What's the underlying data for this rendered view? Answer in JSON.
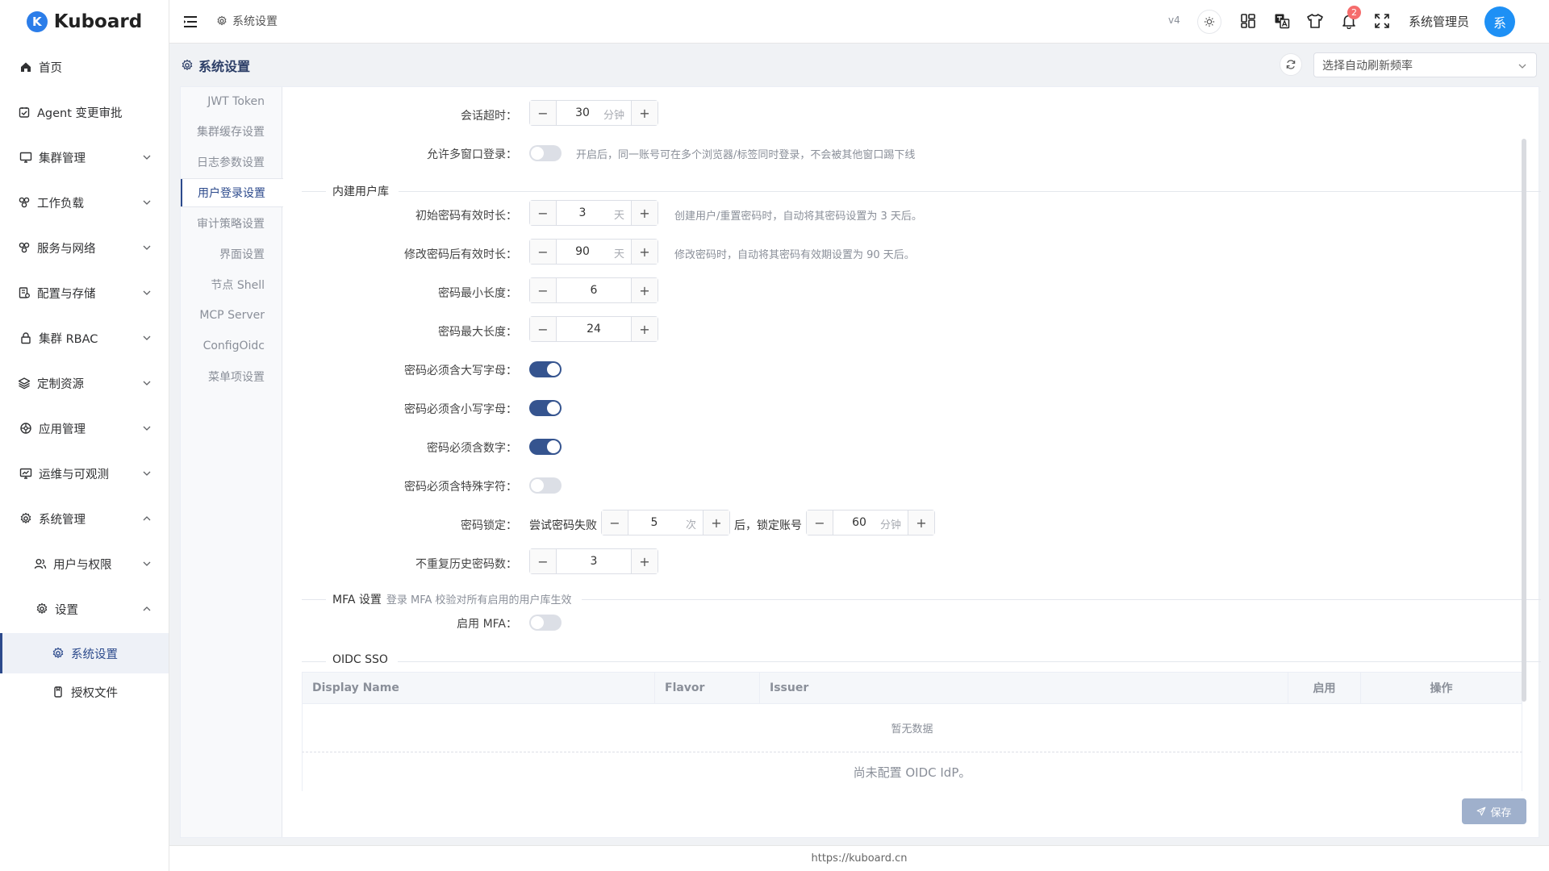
{
  "app": {
    "logo_letter": "K",
    "logo_name": "Kuboard"
  },
  "sidebar": {
    "items": [
      {
        "label": "首页"
      },
      {
        "label": "Agent 变更审批"
      },
      {
        "label": "集群管理"
      },
      {
        "label": "工作负载"
      },
      {
        "label": "服务与网络"
      },
      {
        "label": "配置与存储"
      },
      {
        "label": "集群 RBAC"
      },
      {
        "label": "定制资源"
      },
      {
        "label": "应用管理"
      },
      {
        "label": "运维与可观测"
      },
      {
        "label": "系统管理"
      },
      {
        "label": "用户与权限"
      },
      {
        "label": "设置"
      },
      {
        "label": "系统设置"
      },
      {
        "label": "授权文件"
      }
    ]
  },
  "header": {
    "breadcrumb": "系统设置",
    "version": "v4",
    "notification_count": "2",
    "user_name": "系统管理员",
    "avatar_text": "系"
  },
  "page": {
    "title": "系统设置",
    "refresh_placeholder": "选择自动刷新频率"
  },
  "tabs": [
    {
      "label": "JWT Token"
    },
    {
      "label": "集群缓存设置"
    },
    {
      "label": "日志参数设置"
    },
    {
      "label": "用户登录设置"
    },
    {
      "label": "审计策略设置"
    },
    {
      "label": "界面设置"
    },
    {
      "label": "节点 Shell"
    },
    {
      "label": "MCP Server"
    },
    {
      "label": "ConfigOidc"
    },
    {
      "label": "菜单项设置"
    }
  ],
  "form": {
    "session_timeout": {
      "label": "会话超时：",
      "value": "30",
      "unit": "分钟"
    },
    "multi_window": {
      "label": "允许多窗口登录：",
      "enabled": false,
      "hint": "开启后，同一账号可在多个浏览器/标签同时登录，不会被其他窗口踢下线"
    },
    "builtin_section": "内建用户库",
    "init_pwd_valid": {
      "label": "初始密码有效时长：",
      "value": "3",
      "unit": "天",
      "hint": "创建用户/重置密码时，自动将其密码设置为 3 天后。"
    },
    "changed_pwd_valid": {
      "label": "修改密码后有效时长：",
      "value": "90",
      "unit": "天",
      "hint": "修改密码时，自动将其密码有效期设置为 90 天后。"
    },
    "pwd_min_len": {
      "label": "密码最小长度：",
      "value": "6"
    },
    "pwd_max_len": {
      "label": "密码最大长度：",
      "value": "24"
    },
    "req_upper": {
      "label": "密码必须含大写字母：",
      "enabled": true
    },
    "req_lower": {
      "label": "密码必须含小写字母：",
      "enabled": true
    },
    "req_digit": {
      "label": "密码必须含数字：",
      "enabled": true
    },
    "req_special": {
      "label": "密码必须含特殊字符：",
      "enabled": false
    },
    "pwd_lock": {
      "label": "密码锁定：",
      "prefix": "尝试密码失败",
      "attempts": "5",
      "attempts_unit": "次",
      "middle": "后，锁定账号",
      "minutes": "60",
      "minutes_unit": "分钟"
    },
    "no_repeat_history": {
      "label": "不重复历史密码数：",
      "value": "3"
    },
    "mfa_section": "MFA 设置",
    "mfa_section_sub": "登录 MFA 校验对所有启用的用户库生效",
    "enable_mfa": {
      "label": "启用 MFA：",
      "enabled": false
    },
    "oidc_section": "OIDC SSO"
  },
  "oidc_table": {
    "columns": [
      "Display Name",
      "Flavor",
      "Issuer",
      "启用",
      "操作"
    ],
    "empty_text": "暂无数据",
    "note": "尚未配置 OIDC IdP。"
  },
  "actions": {
    "save_label": "保存"
  },
  "footer": {
    "text": "https://kuboard.cn"
  }
}
